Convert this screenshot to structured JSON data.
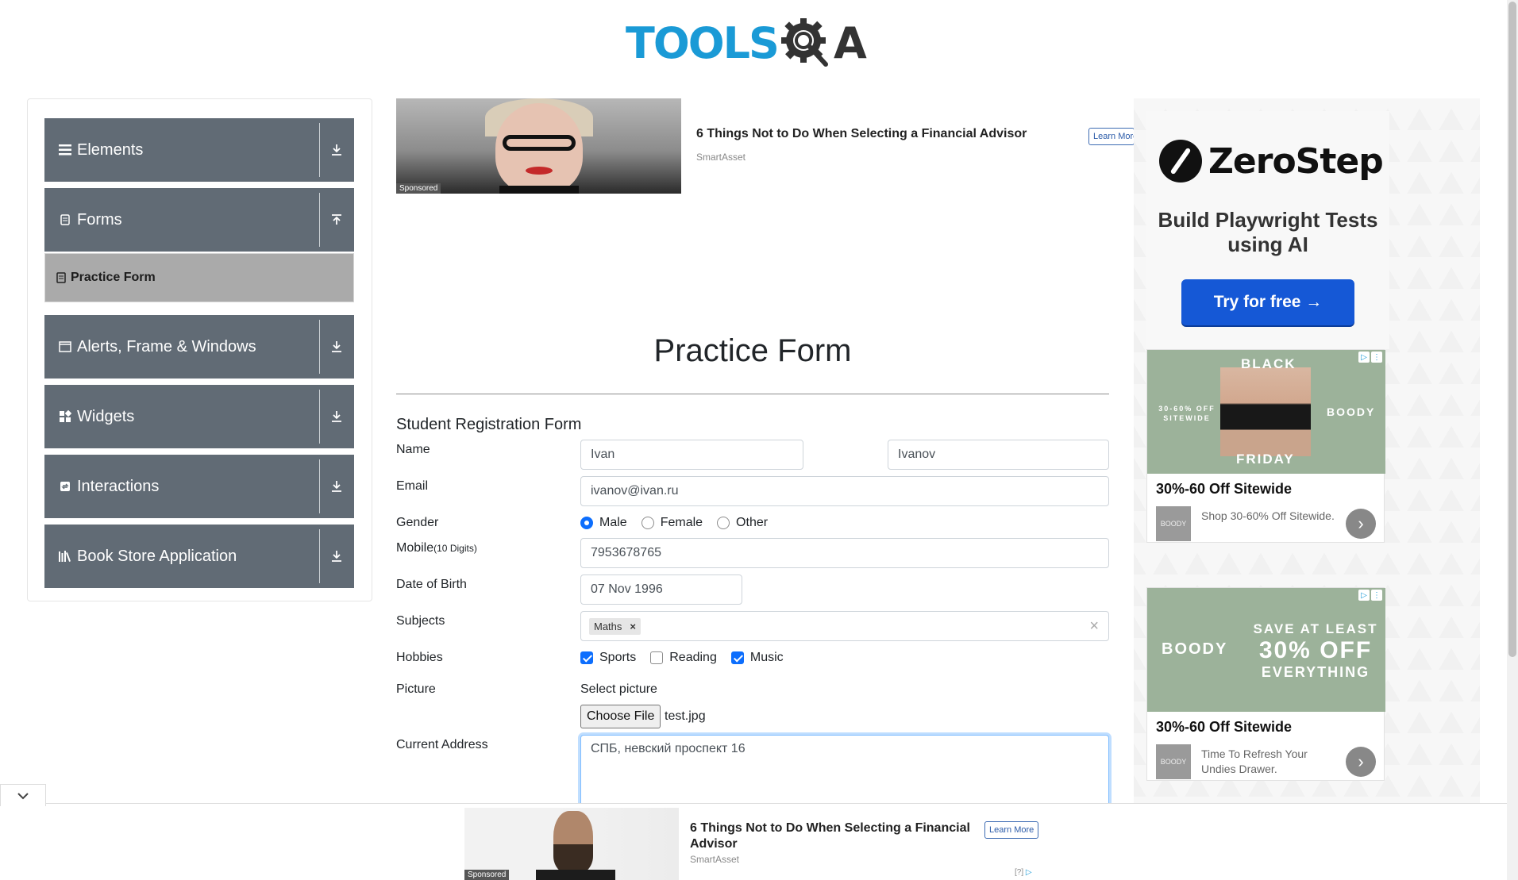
{
  "logo": {
    "text_left": "TOOLS",
    "text_right": "A"
  },
  "sidebar": {
    "groups": [
      {
        "label": "Elements",
        "icon": "list-icon",
        "arrow": "download-icon"
      },
      {
        "label": "Forms",
        "icon": "document-icon",
        "arrow": "upload-icon"
      },
      {
        "label": "Alerts, Frame & Windows",
        "icon": "window-icon",
        "arrow": "download-icon"
      },
      {
        "label": "Widgets",
        "icon": "widgets-icon",
        "arrow": "download-icon"
      },
      {
        "label": "Interactions",
        "icon": "interactions-icon",
        "arrow": "download-icon"
      },
      {
        "label": "Book Store Application",
        "icon": "books-icon",
        "arrow": "download-icon"
      }
    ],
    "active_item": "Practice Form"
  },
  "top_ad": {
    "sponsored": "Sponsored",
    "title": "6 Things Not to Do When Selecting a Financial Advisor",
    "source": "SmartAsset",
    "cta": "Learn More"
  },
  "form": {
    "page_title": "Practice Form",
    "subtitle": "Student Registration Form",
    "labels": {
      "name": "Name",
      "email": "Email",
      "gender": "Gender",
      "mobile": "Mobile",
      "mobile_hint": "(10 Digits)",
      "dob": "Date of Birth",
      "subjects": "Subjects",
      "hobbies": "Hobbies",
      "picture": "Picture",
      "address": "Current Address"
    },
    "first_name": "Ivan",
    "last_name": "Ivanov",
    "email": "ivanov@ivan.ru",
    "gender_options": [
      "Male",
      "Female",
      "Other"
    ],
    "gender_selected": "Male",
    "mobile": "7953678765",
    "dob": "07 Nov 1996",
    "subjects": [
      "Maths"
    ],
    "subject_remove": "×",
    "subjects_clear": "×",
    "hobbies": [
      {
        "label": "Sports",
        "checked": true
      },
      {
        "label": "Reading",
        "checked": false
      },
      {
        "label": "Music",
        "checked": true
      }
    ],
    "picture_prompt": "Select picture",
    "choose_file": "Choose File",
    "file_name": "test.jpg",
    "address": "СПБ, невский проспект 16"
  },
  "right_ads": {
    "zerostep": {
      "brand": "ZeroStep",
      "headline": "Build Playwright Tests using AI",
      "cta": "Try for free →"
    },
    "boody1": {
      "banner_top": "BLACK",
      "banner_bottom": "FRIDAY",
      "banner_side": "30-60% OFF SITEWIDE",
      "brand": "BOODY",
      "title": "30%-60 Off Sitewide",
      "description": "Shop 30-60% Off Sitewide.",
      "thumb": "BOODY"
    },
    "boody2": {
      "brand": "BOODY",
      "banner_line1": "SAVE AT LEAST",
      "banner_line2": "30% OFF",
      "banner_line3": "EVERYTHING",
      "title": "30%-60 Off Sitewide",
      "description": "Time To Refresh Your Undies Drawer.",
      "thumb": "BOODY"
    }
  },
  "bottom_ad": {
    "sponsored": "Sponsored",
    "title": "6 Things Not to Do When Selecting a Financial Advisor",
    "source": "SmartAsset",
    "cta": "Learn More",
    "adchoices": "[?]"
  },
  "colors": {
    "sidebar_group_bg": "#616b75",
    "active_item_bg": "#aaaaaa",
    "brand_blue": "#1a9ad6",
    "primary": "#0d6efd",
    "zerostep_button": "#1558d6",
    "boody_green": "#9cb29a"
  }
}
